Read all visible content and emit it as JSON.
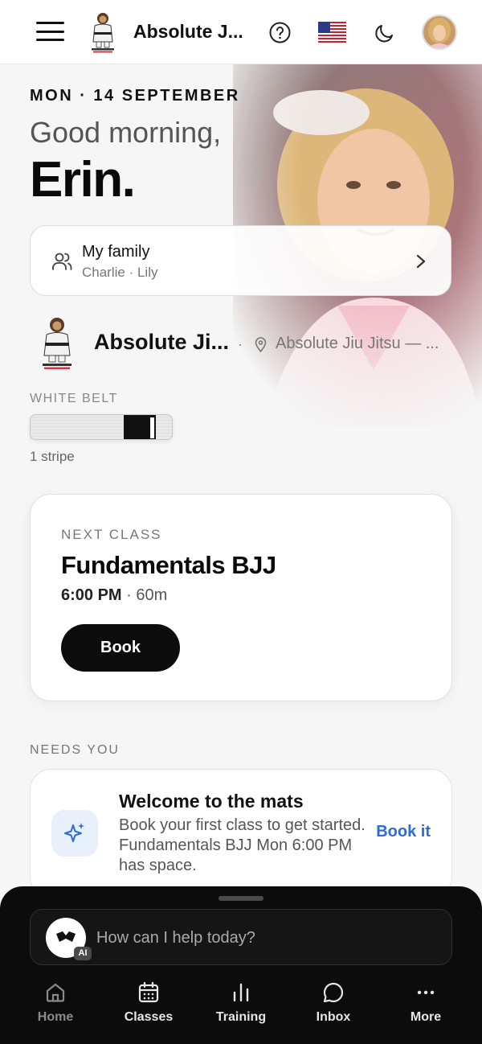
{
  "header": {
    "brand": "Absolute J...",
    "icons": [
      "menu-icon",
      "help-icon",
      "us-flag-icon",
      "moon-icon",
      "user-avatar"
    ]
  },
  "hero": {
    "date": "MON · 14 SEPTEMBER",
    "greeting": "Good morning,",
    "name": "Erin."
  },
  "family": {
    "title": "My family",
    "members": "Charlie · Lily"
  },
  "gym": {
    "name": "Absolute Ji...",
    "separator": "·",
    "location": "Absolute Jiu Jitsu — ..."
  },
  "belt": {
    "label": "WHITE BELT",
    "stripes": "1 stripe",
    "stripe_count": 1
  },
  "next_class": {
    "label": "NEXT CLASS",
    "title": "Fundamentals BJJ",
    "time": "6:00 PM",
    "separator": "·",
    "duration": "60m",
    "book_label": "Book"
  },
  "needs_you": {
    "label": "NEEDS YOU",
    "card": {
      "title": "Welcome to the mats",
      "body": "Book your first class to get started. Fundamentals BJJ Mon 6:00 PM has space.",
      "action": "Book it"
    }
  },
  "assistant": {
    "placeholder": "How can I help today?",
    "badge": "AI"
  },
  "bottom_nav": [
    {
      "label": "Home",
      "icon": "home-icon",
      "active": true
    },
    {
      "label": "Classes",
      "icon": "calendar-icon",
      "active": false
    },
    {
      "label": "Training",
      "icon": "bar-chart-icon",
      "active": false
    },
    {
      "label": "Inbox",
      "icon": "chat-icon",
      "active": false
    },
    {
      "label": "More",
      "icon": "more-icon",
      "active": false
    }
  ],
  "colors": {
    "accent": "#2d6bd6",
    "sheet": "#0c0c0c",
    "background": "#f6f6f6"
  }
}
